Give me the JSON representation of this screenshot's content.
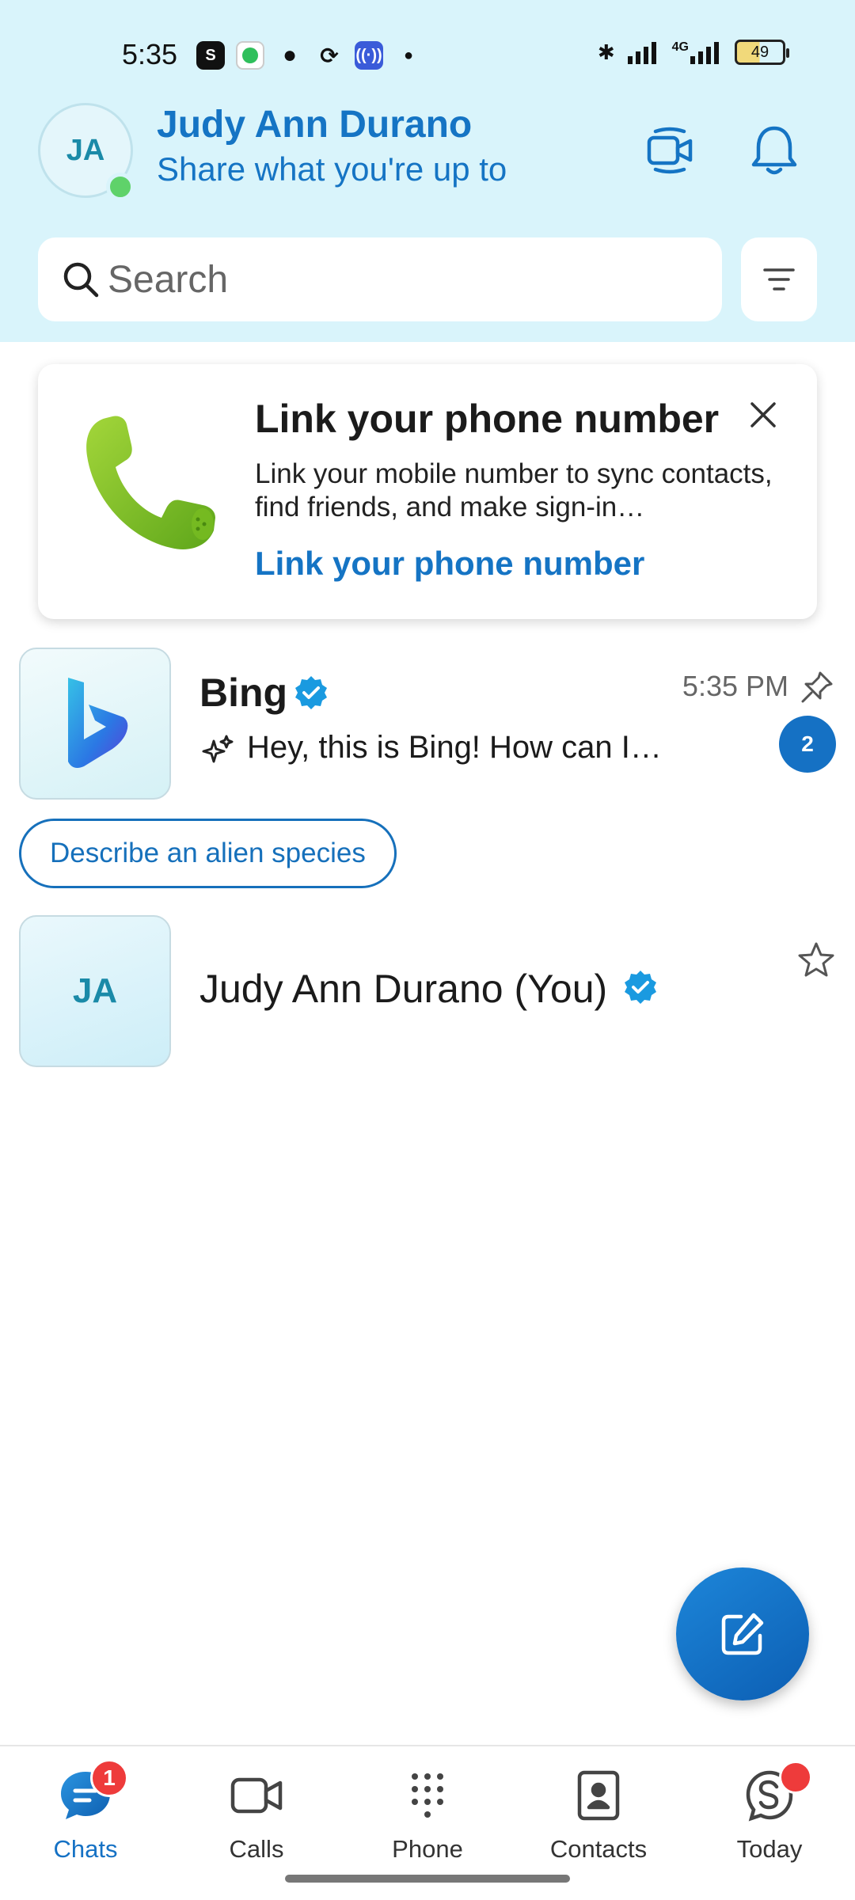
{
  "status_bar": {
    "time": "5:35",
    "battery": "49",
    "network": "4G"
  },
  "profile": {
    "initials": "JA",
    "name": "Judy Ann Durano",
    "status_prompt": "Share what you're up to"
  },
  "search": {
    "placeholder": "Search"
  },
  "link_card": {
    "title": "Link your phone number",
    "description": "Link your mobile number to sync contacts, find friends, and make sign-in…",
    "link_label": "Link your phone number"
  },
  "chats": [
    {
      "name": "Bing",
      "time": "5:35 PM",
      "preview": "Hey, this is Bing! How can I…",
      "unread": "2",
      "suggestion": "Describe an alien species"
    },
    {
      "initials": "JA",
      "name": "Judy Ann Durano (You)"
    }
  ],
  "nav": {
    "items": [
      {
        "label": "Chats",
        "badge": "1"
      },
      {
        "label": "Calls"
      },
      {
        "label": "Phone"
      },
      {
        "label": "Contacts"
      },
      {
        "label": "Today"
      }
    ]
  },
  "colors": {
    "accent": "#1574c4",
    "header_bg": "#d9f4fb",
    "badge": "#ee3b3b",
    "presence": "#5fd26a"
  },
  "icons": [
    "video-call-icon",
    "bell-icon",
    "search-icon",
    "filter-icon",
    "close-icon",
    "phone-icon",
    "bing-logo-icon",
    "verified-icon",
    "pin-icon",
    "sparkle-icon",
    "star-icon",
    "compose-icon",
    "chats-icon",
    "calls-icon",
    "dialpad-icon",
    "contacts-icon",
    "today-icon"
  ]
}
